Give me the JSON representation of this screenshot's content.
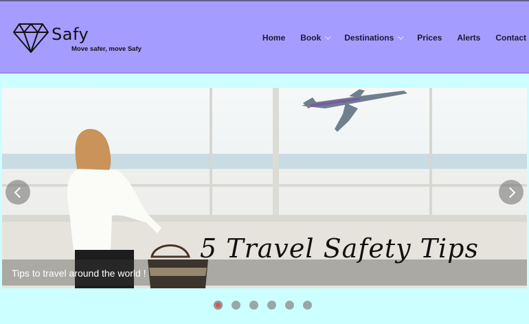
{
  "header": {
    "brand": "Safy",
    "tagline": "Move safer, move Safy",
    "background_color": "#a59cff",
    "logo_icon": "diamond-icon"
  },
  "nav": {
    "items": [
      {
        "label": "Home",
        "has_dropdown": false
      },
      {
        "label": "Book",
        "has_dropdown": true
      },
      {
        "label": "Destinations",
        "has_dropdown": true
      },
      {
        "label": "Prices",
        "has_dropdown": false
      },
      {
        "label": "Alerts",
        "has_dropdown": false
      },
      {
        "label": "Contact",
        "has_dropdown": false
      }
    ]
  },
  "slider": {
    "headline": "5 Travel Safety Tips",
    "caption": "Tips to travel around the world !",
    "prev_icon": "chevron-left-icon",
    "next_icon": "chevron-right-icon",
    "slide_count": 6,
    "active_slide": 1
  },
  "colors": {
    "page_background": "#ccffff",
    "accent_dot": "#e05050"
  }
}
